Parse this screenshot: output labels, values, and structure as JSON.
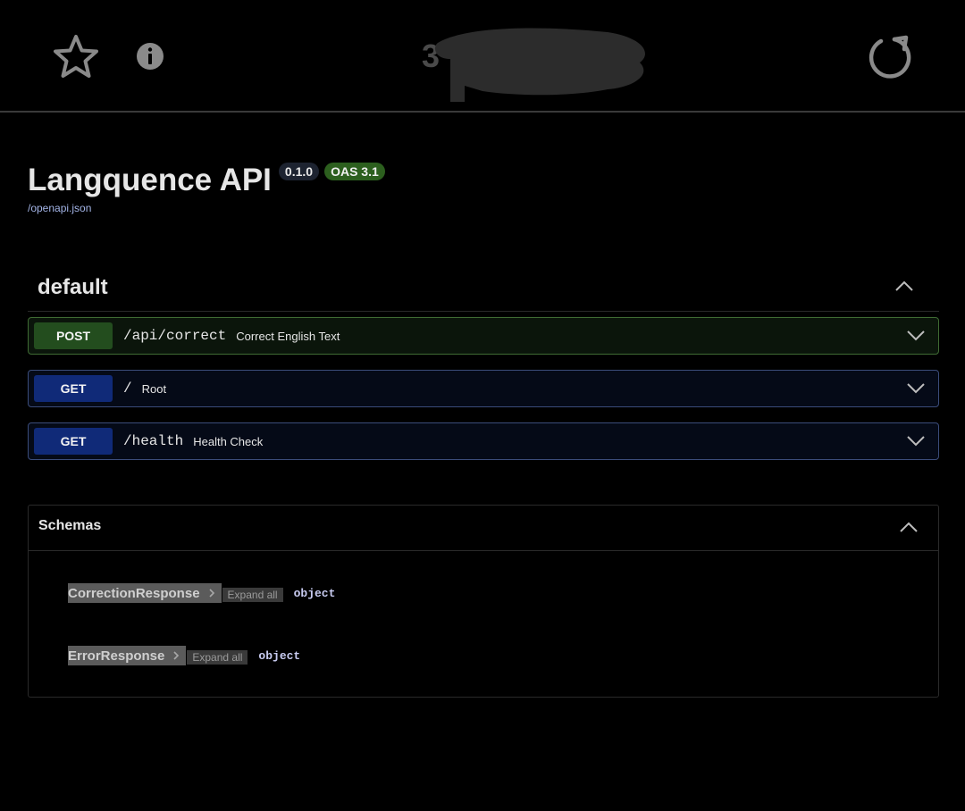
{
  "browser": {
    "url_text": "3"
  },
  "info": {
    "title": "Langquence API",
    "version": "0.1.0",
    "oas": "OAS 3.1",
    "spec_link": "/openapi.json"
  },
  "section": {
    "title": "default",
    "operations": [
      {
        "method": "POST",
        "path": "/api/correct",
        "summary": "Correct English Text"
      },
      {
        "method": "GET",
        "path": "/",
        "summary": "Root"
      },
      {
        "method": "GET",
        "path": "/health",
        "summary": "Health Check"
      }
    ]
  },
  "schemas": {
    "title": "Schemas",
    "expand_label": "Expand all",
    "models": [
      {
        "name": "CorrectionResponse",
        "type": "object"
      },
      {
        "name": "ErrorResponse",
        "type": "object"
      }
    ]
  },
  "colors": {
    "post": "#234d1e",
    "get": "#102a78",
    "oas_badge": "#2c5f1e"
  },
  "icons": [
    "star-icon",
    "info-icon",
    "reload-icon",
    "chevron-up-icon",
    "chevron-down-icon",
    "chevron-right-icon"
  ]
}
